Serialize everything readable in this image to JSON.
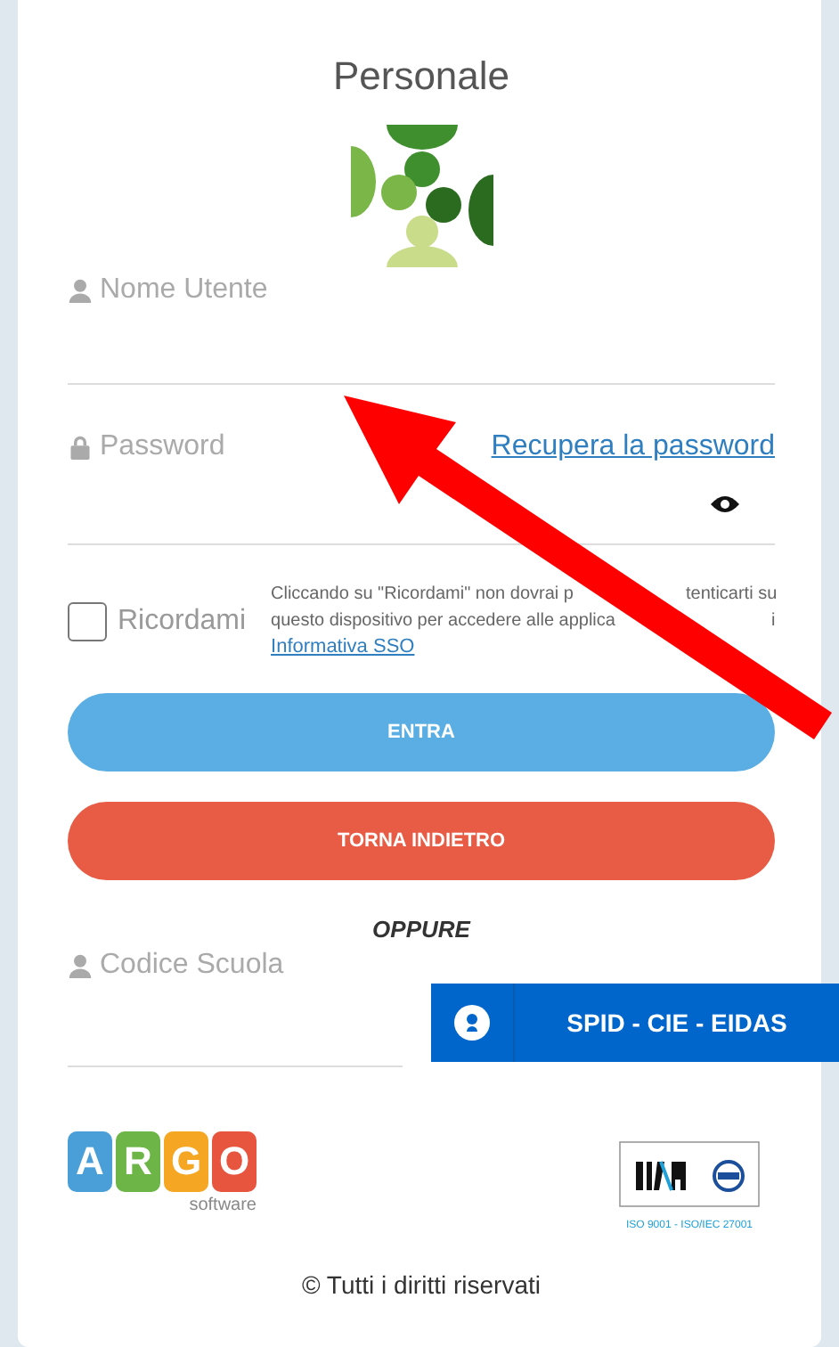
{
  "title": "Personale",
  "username_field": {
    "label": "Nome Utente"
  },
  "password_field": {
    "label": "Password",
    "recover_link": "Recupera la password"
  },
  "remember": {
    "label": "Ricordami",
    "checked": false,
    "note_lines": [
      [
        "Cliccando su \"Ricordami\" non dovrai p",
        "tenticarti su"
      ],
      [
        "questo dispositivo per accedere alle applica",
        "i"
      ]
    ],
    "note_link": "Informativa SSO"
  },
  "buttons": [
    {
      "kind": "primary",
      "label": "ENTRA"
    },
    {
      "kind": "danger",
      "label": "TORNA INDIETRO"
    }
  ],
  "separator": "OPPURE",
  "school_code_field": {
    "label": "Codice Scuola"
  },
  "spid_button": {
    "label": "SPID - CIE - EIDAS"
  },
  "footer": {
    "argo_letters": [
      "A",
      "R",
      "G",
      "O"
    ],
    "argo_subtitle": "software",
    "rina_caption": "ISO 9001 - ISO/IEC 27001",
    "copyright": "© Tutti i diritti riservati"
  }
}
